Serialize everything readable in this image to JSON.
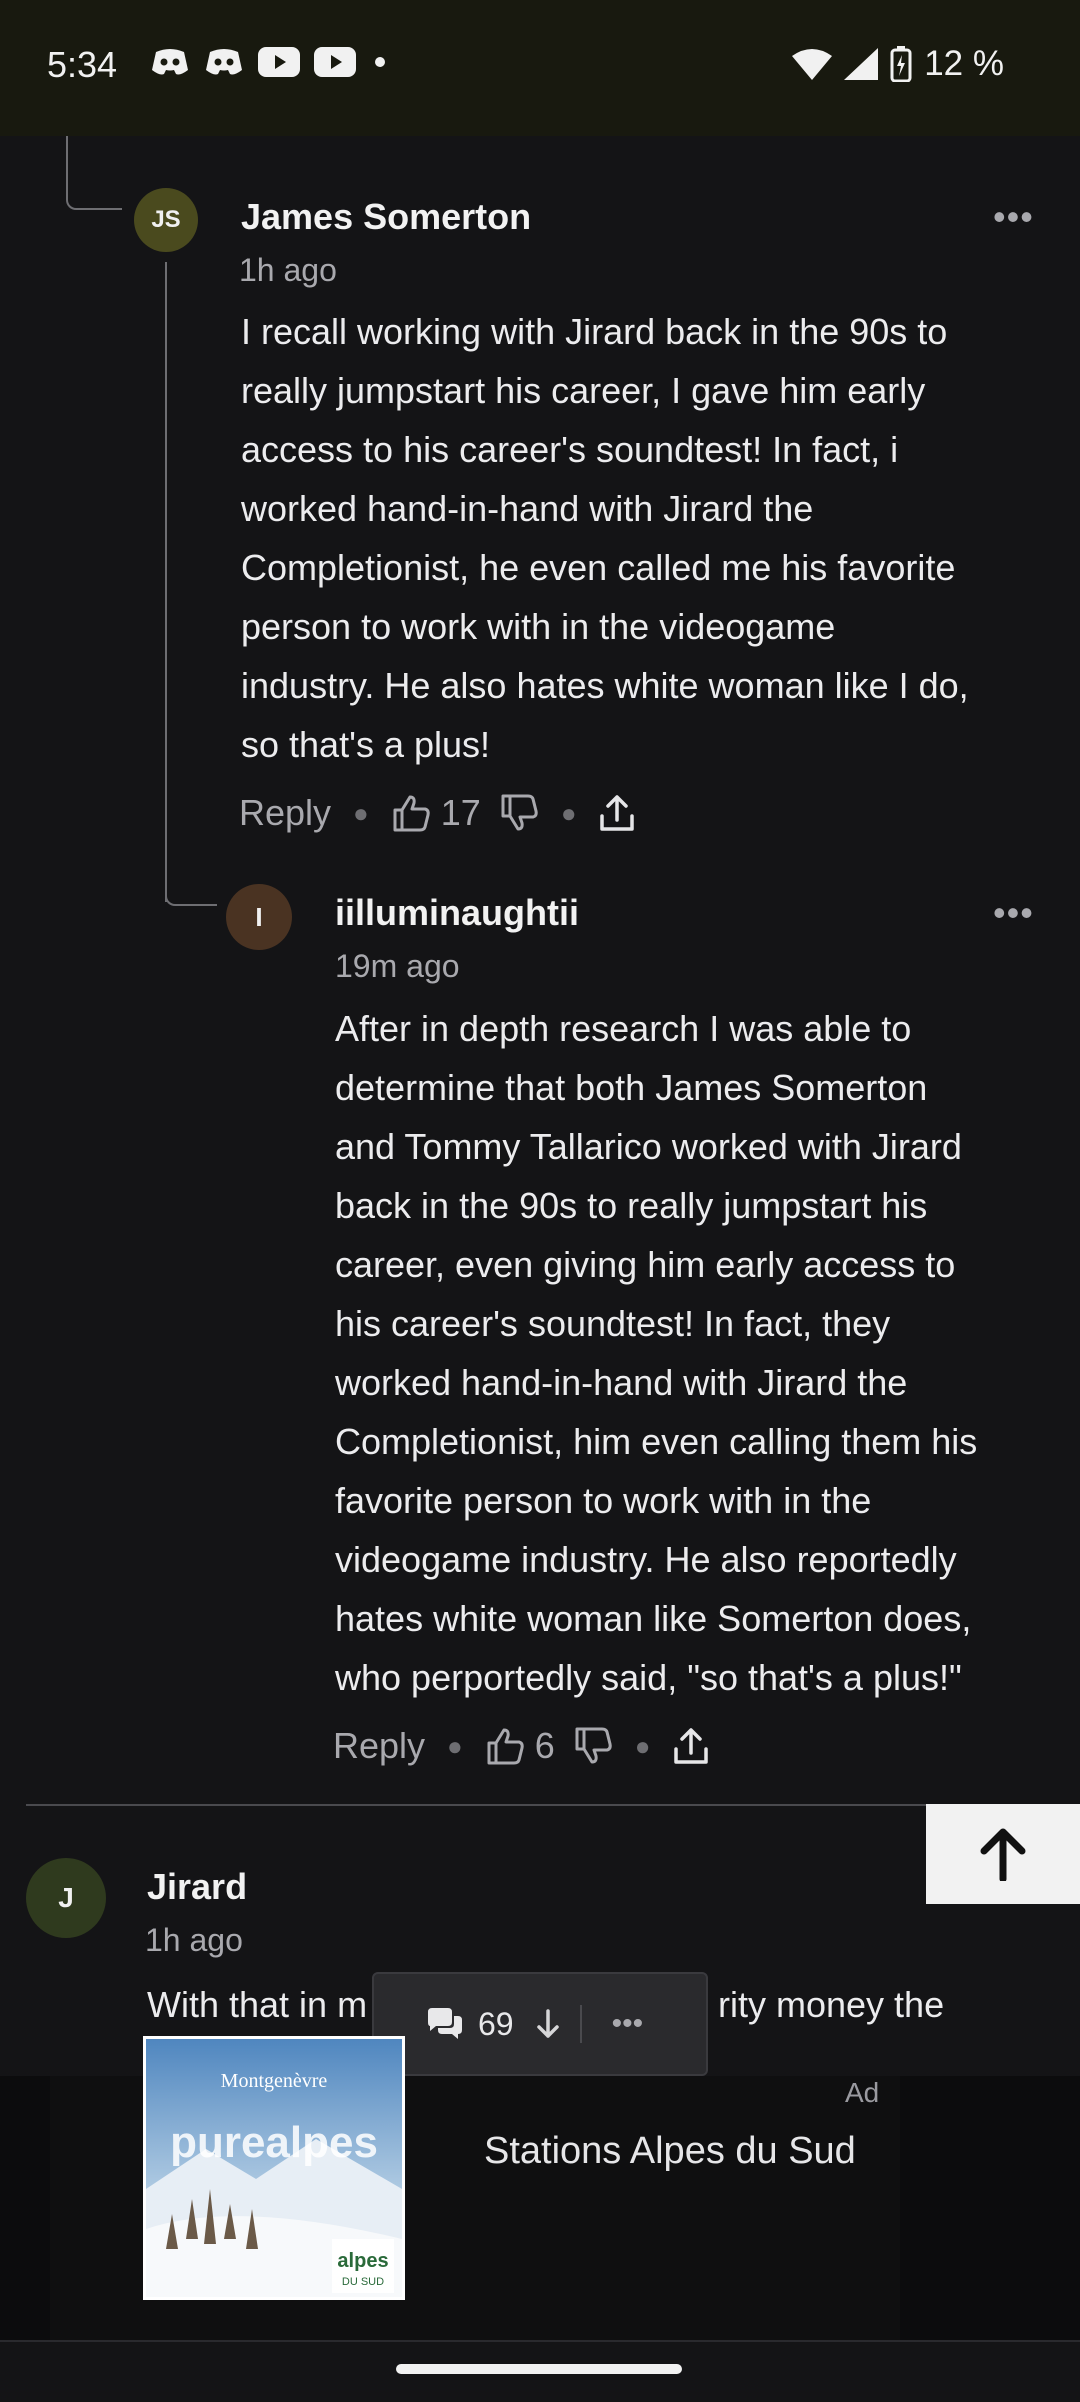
{
  "status_bar": {
    "time": "5:34",
    "battery": "12 %",
    "icons": [
      "discord-icon",
      "discord-icon",
      "youtube-icon",
      "youtube-icon",
      "dot-icon",
      "wifi-icon",
      "signal-icon",
      "battery-icon"
    ]
  },
  "comments": [
    {
      "avatar_initials": "JS",
      "avatar_color": "#4a4a1e",
      "author": "James Somerton",
      "time": "1h ago",
      "lines": [
        "I recall working with Jirard back in the 90s to",
        "really jumpstart his career, I gave him early",
        "access to his career's soundtest! In fact, i",
        "worked hand-in-hand with Jirard the",
        "Completionist, he even called me his favorite",
        "person to work with in the videogame",
        "industry. He also hates white woman like I do,",
        "so that's a plus!"
      ],
      "reply_label": "Reply",
      "likes": "17"
    },
    {
      "avatar_initials": "I",
      "avatar_color": "#4a3322",
      "author": "iilluminaughtii",
      "time": "19m ago",
      "lines": [
        "After in depth research I was able to",
        "determine that both James Somerton",
        "and Tommy Tallarico worked with Jirard",
        "back in the 90s to really jumpstart his",
        "career, even giving him early access to",
        "his career's soundtest! In fact, they",
        "worked hand-in-hand with Jirard the",
        "Completionist, him even calling them his",
        "favorite person to work with in the",
        "videogame industry. He also reportedly",
        "hates white woman like Somerton does,",
        "who perportedly said, \"so that's a plus!\""
      ],
      "reply_label": "Reply",
      "likes": "6"
    },
    {
      "avatar_initials": "J",
      "avatar_color": "#2f3a1e",
      "author": "Jirard",
      "time": "1h ago",
      "line_left": "With that in m",
      "line_right": "rity money the"
    }
  ],
  "float_bar": {
    "comment_count": "69"
  },
  "ad": {
    "label": "Ad",
    "title": "Stations Alpes du Sud",
    "image_brand": "Montgenèvre",
    "image_text": "purealpes",
    "image_logo": "alpes",
    "image_logo_sub": "DU SUD"
  },
  "colors": {
    "background": "#141416",
    "status_bar": "#18190f",
    "text_secondary": "#a9a9ae"
  }
}
